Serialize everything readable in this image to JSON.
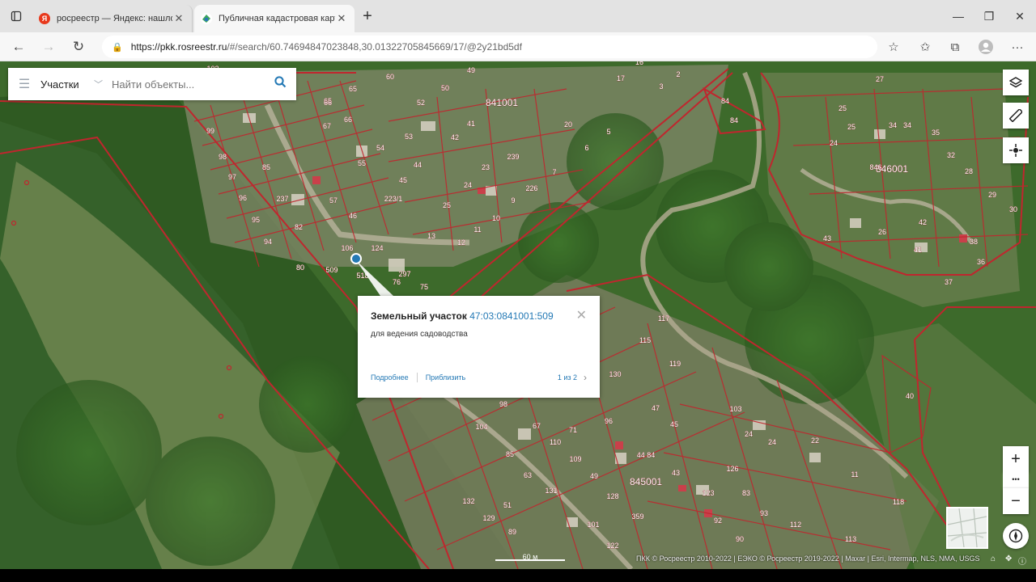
{
  "browser": {
    "tabs": [
      {
        "favicon_letter": "Я",
        "favicon_color": "#e8391c",
        "title": "росреестр — Яндекс: нашлось 2..."
      },
      {
        "favicon_letter": "",
        "favicon_color": "#3aa35f",
        "title": "Публичная кадастровая карта"
      }
    ],
    "new_tab": "+",
    "window_controls": {
      "minimize": "—",
      "maximize": "❐",
      "close": "✕"
    },
    "url_host": "https://pkk.rosreestr.ru",
    "url_path": "/#/search/60.74694847023848,30.01322705845669/17/@2y21bd5df",
    "nav": {
      "back": "←",
      "forward": "→",
      "reload": "↻"
    }
  },
  "search": {
    "type_label": "Участки",
    "placeholder": "Найти объекты..."
  },
  "popup": {
    "object_type": "Земельный участок",
    "cadastral_number": "47:03:0841001:509",
    "description": "для ведения садоводства",
    "details_link": "Подробнее",
    "zoom_link": "Приблизить",
    "pager": "1 из 2"
  },
  "map": {
    "blocks": [
      "841001",
      "846001",
      "845001"
    ],
    "parcels": [
      "102",
      "65",
      "60",
      "50",
      "49",
      "66",
      "65",
      "52",
      "50",
      "16",
      "17",
      "3",
      "2",
      "84",
      "84",
      "99",
      "67",
      "66",
      "54",
      "53",
      "41",
      "42",
      "20",
      "5",
      "27",
      "98",
      "55",
      "44",
      "45",
      "6",
      "239",
      "23",
      "7",
      "25",
      "34",
      "97",
      "85",
      "237",
      "223/1",
      "24",
      "25",
      "34",
      "35",
      "96",
      "57",
      "9",
      "226",
      "25",
      "10",
      "13",
      "12",
      "11",
      "24",
      "32",
      "95",
      "82",
      "46",
      "28",
      "846",
      "29",
      "94",
      "80",
      "509",
      "518",
      "76",
      "297",
      "75",
      "42",
      "43",
      "26",
      "41",
      "38",
      "30",
      "36",
      "37",
      "117",
      "115",
      "119",
      "130",
      "103",
      "40",
      "98",
      "104",
      "67",
      "96",
      "45",
      "47",
      "110",
      "71",
      "24",
      "24",
      "22",
      "85",
      "44 84",
      "109",
      "126",
      "11",
      "63",
      "49",
      "131",
      "123",
      "51",
      "128",
      "43",
      "83",
      "132",
      "129",
      "359",
      "93",
      "118",
      "89",
      "101",
      "92",
      "112",
      "122",
      "90",
      "113",
      "106",
      "124"
    ],
    "scale_label": "60 м",
    "attribution": "ПКК © Росреестр 2010-2022 | ЕЭКО © Росреестр 2019-2022 | Maxar | Esri, Intermap, NLS, NMA, USGS"
  },
  "map_controls": {
    "layers": "layers-icon",
    "measure": "ruler-icon",
    "locate": "crosshair-icon",
    "zoom_in": "+",
    "more": "•••",
    "zoom_out": "−",
    "compass": "compass-icon"
  }
}
